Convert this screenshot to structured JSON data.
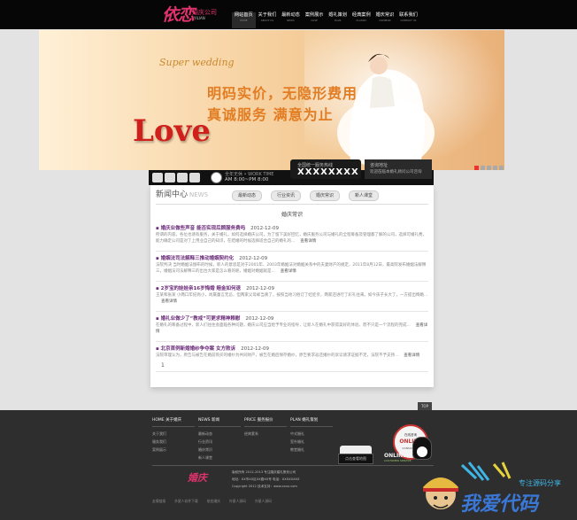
{
  "header": {
    "logo": {
      "main": "依恋",
      "sub": "婚庆公司",
      "en": "YILIAN"
    },
    "nav": [
      {
        "label": "网站首页",
        "en": "HOME"
      },
      {
        "label": "关于我们",
        "en": "ABOUT US"
      },
      {
        "label": "最新动态",
        "en": "NEWS"
      },
      {
        "label": "案例展示",
        "en": "CASE"
      },
      {
        "label": "婚礼策划",
        "en": "PLAN"
      },
      {
        "label": "经典案例",
        "en": "CLASSIC"
      },
      {
        "label": "婚庆常识",
        "en": "COMMON"
      },
      {
        "label": "联系我们",
        "en": "CONTACT US"
      }
    ]
  },
  "banner": {
    "script": "Super wedding",
    "slogan_line1": "明码实价，无隐形费用",
    "slogan_line2": "真诚服务  满意为止",
    "love": "Love"
  },
  "infobar": {
    "work_time_label": "全年无休 • WORK TIME",
    "work_time": "AM 8:00~PM 8:00",
    "hotline_label": "全国统一服务热线",
    "hotline": "XXXXXXXX",
    "consult_label": "咨询地址",
    "consult_text": "欢迎莅临本婚礼顾问公司咨询"
  },
  "news": {
    "title": "新闻中心",
    "title_en": "NEWS",
    "tabs": [
      "最新动态",
      "行业资讯",
      "婚庆常识",
      "新人课堂"
    ],
    "section_title": "婚庆常识",
    "articles": [
      {
        "title": "婚庆业做些声音 能否实现后顾服务费吗",
        "date": "2012-12-09",
        "summary": "所谓的内容，各位也请有服务，关于婚礼，如何选择婚庆公司，为了留下美好回忆，婚庆服务公司与婚礼的全程筹备及管理都了解的公司，选择可婚礼费，能力确定公司是对了上用业自己的知识，在结婚的时候选择适合自己的婚礼的...",
        "more": "查看详情"
      },
      {
        "title": "婚姻法司法解释三推动婚姻契约化",
        "date": "2012-12-09",
        "summary": "法院判决 当时婚姻法颁布的时候，新人的意思是对于2001年、2003年婚姻法对婚姻关系中的夫妻财产的规定，2011年8月12日，最高院发布婚姻法解释三，婚姻法司法解释三的出台大家是怎么看的呢，婚姻对婚姻就是...",
        "more": "查看详情"
      },
      {
        "title": "2岁宝的娃娃亲16岁悔婚 赔金如何退",
        "date": "2012-12-09",
        "summary": "王某和张某 小两口年纪尚小，尚属童言无忌，但两家父母却当真了，按照当地习俗订了娃娃亲，两家还进行了彩礼往来。如今孩子长大了，一方提出悔婚...",
        "more": "查看详情"
      },
      {
        "title": "婚礼业做少了“教戒”可更求精神粮慰",
        "date": "2012-12-09",
        "summary": "在婚礼的筹备过程中，新人们往往会面临各种问题，婚庆公司应当给予专业的指导，让新人在婚礼中获得美好的体验，而不只是一个流程的完成...",
        "more": "查看详情"
      },
      {
        "title": "北京首例新婚婚纱争夺案 女方败诉",
        "date": "2012-12-09",
        "summary": "法院审理认为，原告与被告在婚前购买的婚纱为共同财产，被告在婚后保存婚纱，原告要求返还婚纱的诉讼请求证据不足，法院不予支持...",
        "more": "查看详情"
      }
    ],
    "pagination": "1"
  },
  "to_top": "TOP",
  "footer": {
    "columns": [
      {
        "head": "HOME 关于婚庆",
        "links": [
          "关于我们",
          "服务我们",
          "案例展示"
        ]
      },
      {
        "head": "NEWS 新闻",
        "links": [
          "最新动态",
          "行业资讯",
          "婚庆常识",
          "新人课堂"
        ]
      },
      {
        "head": "PRICE 服务报价",
        "links": [
          "经典套系"
        ]
      },
      {
        "head": "PLAN 婚礼策划",
        "links": [
          "中式婚礼",
          "室外婚礼",
          "教堂婚礼"
        ]
      }
    ],
    "book_label": "点击查看地图",
    "online": {
      "t1": "在线咨询",
      "t2": "ONLINE",
      "t3": "CONSULTING",
      "label": "ONLINE",
      "sub": "CUSTOMER SERVICE"
    },
    "logo": "婚庆",
    "copyright": "版权所有 2012-2013 专注婚庆婚礼策划公司",
    "address": "地址：XX市XX区XX路XX号  电话：XXXXXXXX",
    "copyright2": "Copyright 2012  技术支持：www.xxxx.com",
    "links": [
      "友情链接",
      "外星人软件下载",
      "依恋婚庆",
      "外星人源码",
      "外星人源码"
    ]
  },
  "watermark": {
    "text": "我爱代码",
    "sub": "专注源码分享"
  }
}
